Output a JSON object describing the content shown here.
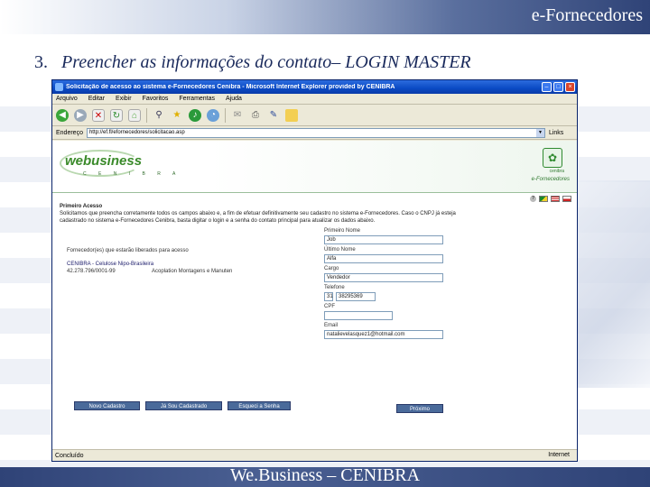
{
  "slide": {
    "brand": "e-Fornecedores",
    "heading_number": "3.",
    "heading_text": "Preencher as informações do contato– LOGIN MASTER",
    "footer": "We.Business – CENIBRA"
  },
  "browser": {
    "title": "Solicitação de acesso ao sistema e-Fornecedores Cenibra - Microsoft Internet Explorer provided by CENIBRA",
    "menu": [
      "Arquivo",
      "Editar",
      "Exibir",
      "Favoritos",
      "Ferramentas",
      "Ajuda"
    ],
    "address_label": "Endereço",
    "address_value": "http://ef.fl/efornecedores/solicitacao.asp",
    "go_label": "Links",
    "status_text": "Concluído",
    "status_zone": "Internet"
  },
  "page": {
    "logo_main": "webusiness",
    "logo_sub": "C E N I B R A",
    "cenibra_label": "cenibra",
    "fornecedores_label": "e-Fornecedores",
    "intro_title": "Primeiro Acesso",
    "intro_text": "Solicitamos que preencha corretamente todos os campos abaixo e, a fim de efetuar definitivamente seu cadastro no sistema e-Fornecedores. Caso o CNPJ já esteja cadastrado no sistema e-Fornecedores Cenibra, basta digitar o login e a senha do contato principal para atualizar os dados abaixo.",
    "supplier_label": "Fornecedor(es) que estarão liberados para acesso",
    "supplier_name": "CENIBRA - Celulose Nipo-Brasileira",
    "supplier_cnpj": "42.278.796/0001-99",
    "supplier_branch": "Acoplation Montagens e Manuten",
    "form": {
      "first_name_label": "Primeiro Nome",
      "first_name_value": "Job",
      "last_name_label": "Último Nome",
      "last_name_value": "Alfa",
      "position_label": "Cargo",
      "position_value": "Vendedor",
      "phone_label": "Telefone",
      "phone_ddd": "31",
      "phone_number": "38295369",
      "cpf_label": "CPF",
      "cpf_value": "",
      "email_label": "Email",
      "email_value": "natalievelasquez1@hotmail.com"
    },
    "next_button": "Próximo",
    "buttons": [
      "Novo Cadastro",
      "Já Sou Cadastrado",
      "Esqueci a Senha"
    ]
  }
}
